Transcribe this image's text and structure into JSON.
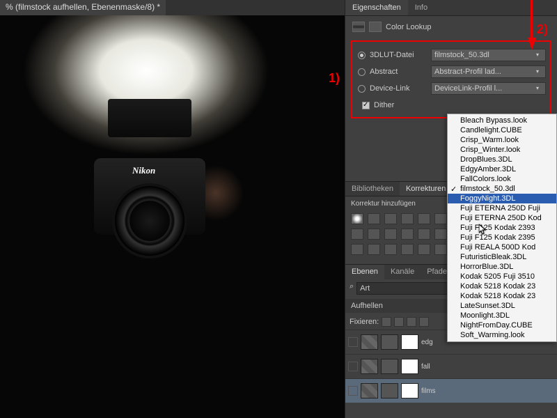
{
  "doc_tab": "% (filmstock aufhellen, Ebenenmaske/8) *",
  "panel_tabs": {
    "properties": "Eigenschaften",
    "info": "Info"
  },
  "prop_title": "Color Lookup",
  "lut": {
    "r1": {
      "label": "3DLUT-Datei",
      "value": "filmstock_50.3dl"
    },
    "r2": {
      "label": "Abstract",
      "value": "Abstract-Profil lad..."
    },
    "r3": {
      "label": "Device-Link",
      "value": "DeviceLink-Profil l..."
    },
    "dither": "Dither"
  },
  "ann": {
    "one": "1)",
    "two": "2)"
  },
  "lib_tabs": {
    "bib": "Bibliotheken",
    "korr": "Korrekturen"
  },
  "korr_add": "Korrektur hinzufügen",
  "layer_tabs": {
    "eb": "Ebenen",
    "kan": "Kanäle",
    "pf": "Pfade"
  },
  "layer_mode": {
    "sel": "Art",
    "search": "⌕"
  },
  "aufhellen": "Aufhellen",
  "fix": "Fixieren:",
  "layers": [
    {
      "name": "edg"
    },
    {
      "name": "fall"
    },
    {
      "name": "films"
    }
  ],
  "camera_brand": "Nikon",
  "menu": {
    "items": [
      "Bleach Bypass.look",
      "Candlelight.CUBE",
      "Crisp_Warm.look",
      "Crisp_Winter.look",
      "DropBlues.3DL",
      "EdgyAmber.3DL",
      "FallColors.look",
      "filmstock_50.3dl",
      "FoggyNight.3DL",
      "Fuji ETERNA 250D Fuji",
      "Fuji ETERNA 250D Kod",
      "Fuji F125 Kodak 2393",
      "Fuji F125 Kodak 2395",
      "Fuji REALA 500D Kod",
      "FuturisticBleak.3DL",
      "HorrorBlue.3DL",
      "Kodak 5205 Fuji 3510",
      "Kodak 5218 Kodak 23",
      "Kodak 5218 Kodak 23",
      "LateSunset.3DL",
      "Moonlight.3DL",
      "NightFromDay.CUBE",
      "Soft_Warming.look"
    ],
    "checked": 7,
    "highlighted": 8
  }
}
